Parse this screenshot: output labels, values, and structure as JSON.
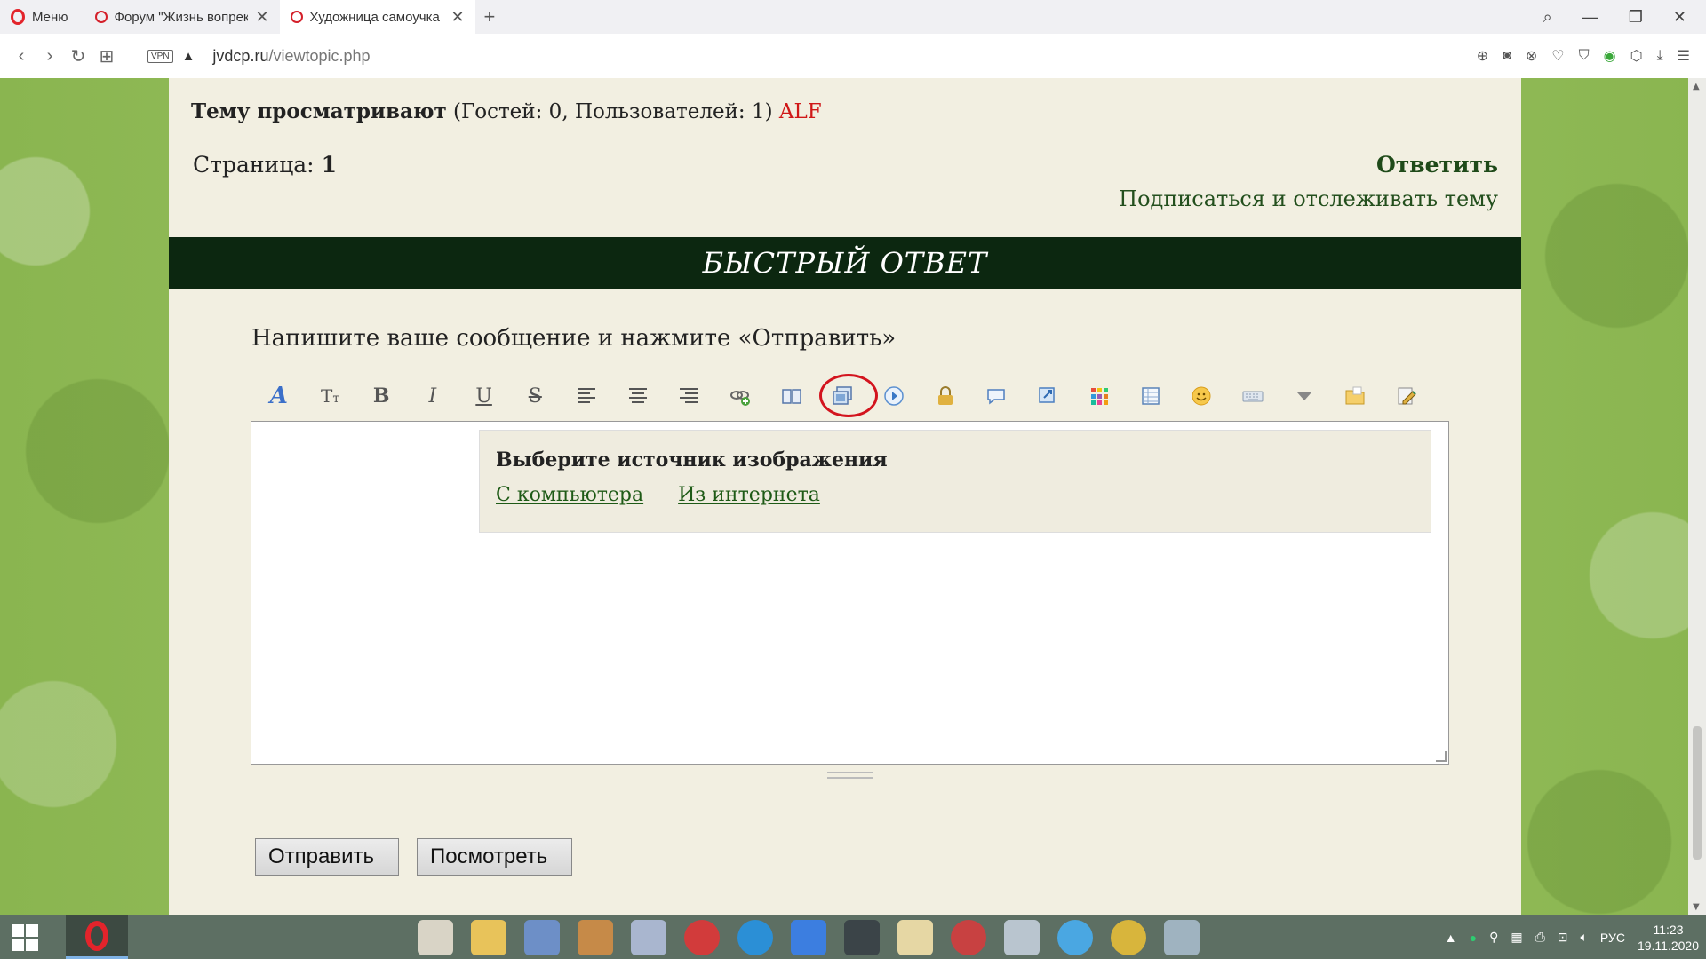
{
  "browser": {
    "menu_label": "Меню",
    "tabs": [
      {
        "title": "Форум \"Жизнь вопреки Д"
      },
      {
        "title": "Художница самоучка"
      }
    ],
    "vpn_label": "VPN",
    "url_domain": "jvdcp.ru",
    "url_path": "/viewtopic.php"
  },
  "page": {
    "viewers_label": "Тему просматривают",
    "viewers_counts": "(Гостей: 0, Пользователей: 1)",
    "viewers_user": "ALF",
    "page_label": "Страница:",
    "page_number": "1",
    "reply_label": "Ответить",
    "subscribe_label": "Подписаться и отслеживать тему",
    "quick_reply_title": "БЫСТРЫЙ ОТВЕТ",
    "instruction": "Напишите ваше сообщение и нажмите «Отправить»",
    "toolbar": [
      {
        "icon": "font-color-icon"
      },
      {
        "icon": "font-size-icon"
      },
      {
        "icon": "bold-icon"
      },
      {
        "icon": "italic-icon"
      },
      {
        "icon": "underline-icon"
      },
      {
        "icon": "strikethrough-icon"
      },
      {
        "icon": "align-left-icon"
      },
      {
        "icon": "align-center-icon"
      },
      {
        "icon": "align-right-icon"
      },
      {
        "icon": "link-icon"
      },
      {
        "icon": "book-icon"
      },
      {
        "icon": "image-icon"
      },
      {
        "icon": "video-play-icon"
      },
      {
        "icon": "lock-icon"
      },
      {
        "icon": "speech-bubble-icon"
      },
      {
        "icon": "quote-icon"
      },
      {
        "icon": "color-grid-icon"
      },
      {
        "icon": "table-icon"
      },
      {
        "icon": "smiley-icon"
      },
      {
        "icon": "keyboard-icon"
      },
      {
        "icon": "dropdown-triangle-icon"
      },
      {
        "icon": "folder-icon"
      },
      {
        "icon": "edit-note-icon"
      }
    ],
    "image_popup": {
      "title": "Выберите источник изображения",
      "from_computer": "С компьютера",
      "from_internet": "Из интернета"
    },
    "send_button": "Отправить",
    "preview_button": "Посмотреть"
  },
  "taskbar": {
    "language": "РУС",
    "time": "11:23",
    "date": "19.11.2020"
  }
}
